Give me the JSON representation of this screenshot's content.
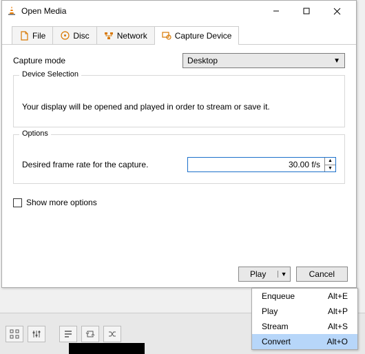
{
  "window": {
    "title": "Open Media"
  },
  "tabs": {
    "file": "File",
    "disc": "Disc",
    "network": "Network",
    "capture": "Capture Device"
  },
  "capture": {
    "mode_label": "Capture mode",
    "mode_value": "Desktop"
  },
  "device_selection": {
    "title": "Device Selection",
    "description": "Your display will be opened and played in order to stream or save it."
  },
  "options": {
    "title": "Options",
    "framerate_label": "Desired frame rate for the capture.",
    "framerate_value": "30.00 f/s"
  },
  "show_more": "Show more options",
  "buttons": {
    "play": "Play",
    "cancel": "Cancel"
  },
  "menu": {
    "enqueue": {
      "label": "Enqueue",
      "accel": "Alt+E"
    },
    "play": {
      "label": "Play",
      "accel": "Alt+P"
    },
    "stream": {
      "label": "Stream",
      "accel": "Alt+S"
    },
    "convert": {
      "label": "Convert",
      "accel": "Alt+O"
    }
  }
}
